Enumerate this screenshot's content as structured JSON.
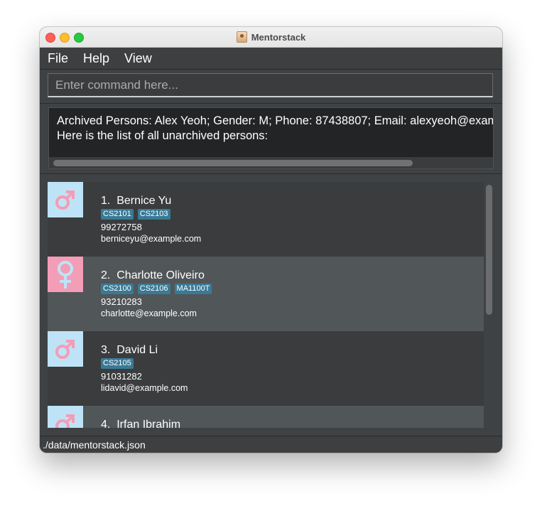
{
  "window": {
    "title": "Mentorstack"
  },
  "menu": {
    "items": [
      {
        "label": "File"
      },
      {
        "label": "Help"
      },
      {
        "label": "View"
      }
    ]
  },
  "command": {
    "placeholder": "Enter command here..."
  },
  "result": {
    "line1": "Archived Persons: Alex Yeoh; Gender: M; Phone: 87438807; Email: alexyeoh@example.com",
    "line2": "Here is the list of all unarchived persons:"
  },
  "persons": [
    {
      "index": "1.",
      "name": "Bernice Yu",
      "gender": "M",
      "gender_icon": "male-icon",
      "tags": [
        "CS2101",
        "CS2103"
      ],
      "phone": "99272758",
      "email": "berniceyu@example.com"
    },
    {
      "index": "2.",
      "name": "Charlotte Oliveiro",
      "gender": "F",
      "gender_icon": "female-icon",
      "tags": [
        "CS2100",
        "CS2106",
        "MA1100T"
      ],
      "phone": "93210283",
      "email": "charlotte@example.com"
    },
    {
      "index": "3.",
      "name": "David Li",
      "gender": "M",
      "gender_icon": "male-icon",
      "tags": [
        "CS2105"
      ],
      "phone": "91031282",
      "email": "lidavid@example.com"
    },
    {
      "index": "4.",
      "name": "Irfan Ibrahim",
      "gender": "M",
      "gender_icon": "male-icon",
      "tags": [],
      "phone": "",
      "email": ""
    }
  ],
  "status": {
    "path": "./data/mentorstack.json"
  },
  "colors": {
    "male_bg": "#bfe3f6",
    "male_symbol": "#f39db6",
    "female_bg": "#f39db6",
    "female_symbol": "#bfe3f6",
    "tag_bg": "#3a7a96"
  }
}
